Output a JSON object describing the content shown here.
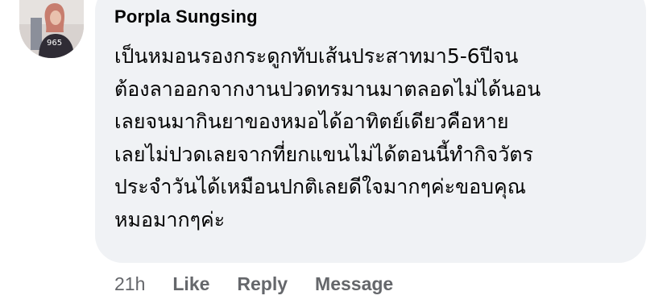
{
  "comment": {
    "author": "Porpla Sungsing",
    "avatar_icon": "profile-photo-icon",
    "text_lines": [
      "เป็นหมอนรองกระดูกทับเส้นประสาทมา5-6ปีจน",
      "ต้องลาออกจากงานปวดทรมานมาตลอดไม่ได้นอน",
      "เลยจนมากินยาของหมอได้อาทิตย์เดียวคือหาย",
      "เลยไม่ปวดเลยจากที่ยกแขนไม่ได้ตอนนี้ทำกิจวัตร",
      "ประจำวันได้เหมือนปกติเลยดีใจมากๆค่ะขอบคุณ",
      "หมอมากๆค่ะ"
    ],
    "avatar_text": "965",
    "timestamp": "21h",
    "actions": {
      "like": "Like",
      "reply": "Reply",
      "message": "Message"
    },
    "colors": {
      "bubble": "#f0f2f5",
      "text": "#050505",
      "meta": "#65676b"
    }
  }
}
